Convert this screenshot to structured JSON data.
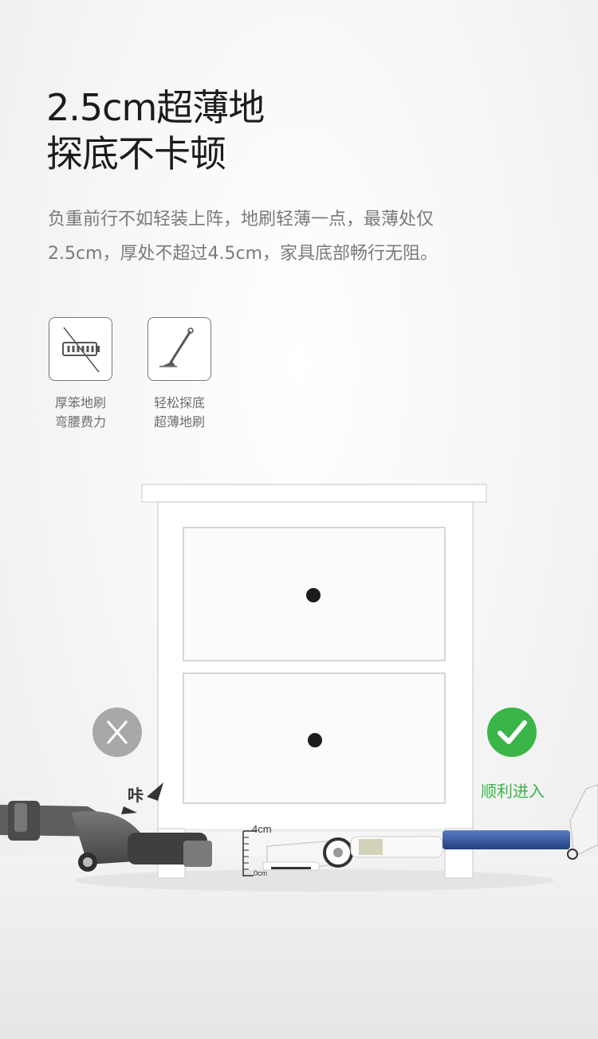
{
  "headline": {
    "line1": "2.5cm超薄地",
    "line2": "探底不卡顿"
  },
  "description": {
    "line1": "负重前行不如轻装上阵，地刷轻薄一点，最薄处仅",
    "line2": "2.5cm，厚处不超过4.5cm，家具底部畅行无阻。"
  },
  "features": [
    {
      "icon": "crossed-battery-icon",
      "line1": "厚笨地刷",
      "line2": "弯腰费力"
    },
    {
      "icon": "slim-brush-icon",
      "line1": "轻松探底",
      "line2": "超薄地刷"
    }
  ],
  "scene": {
    "fail_sound": "咔",
    "success_label": "顺利进入",
    "ruler_top": "4cm",
    "ruler_bottom": "0cm"
  },
  "colors": {
    "success_green": "#3bb54a",
    "fail_gray": "#a8a8a8",
    "blue_tube": "#2c4f9e"
  }
}
